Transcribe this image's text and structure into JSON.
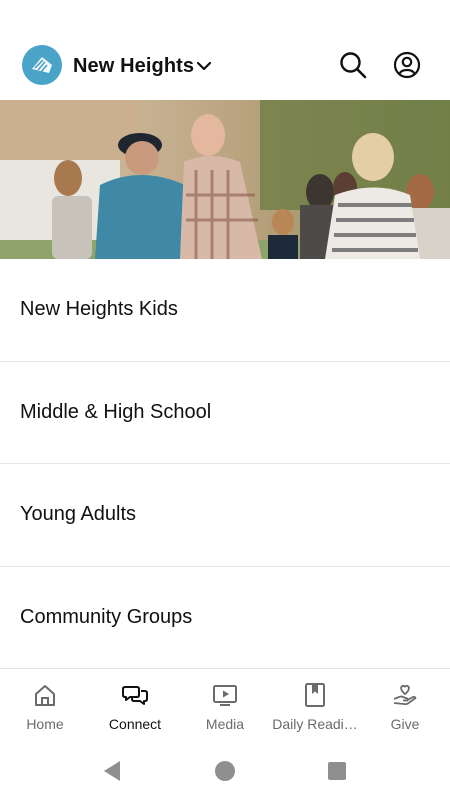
{
  "header": {
    "org_name": "New Heights",
    "logo_icon": "new-heights-logo",
    "dropdown_icon": "chevron-down-icon",
    "search_icon": "search-icon",
    "account_icon": "account-circle-icon",
    "brand_color": "#4aa3c8"
  },
  "hero": {
    "image_description_icon": "hero-photo"
  },
  "menu": {
    "items": [
      {
        "label": "New Heights Kids"
      },
      {
        "label": "Middle & High School"
      },
      {
        "label": "Young Adults"
      },
      {
        "label": "Community Groups"
      }
    ]
  },
  "bottom_nav": {
    "active": "Connect",
    "items": [
      {
        "label": "Home",
        "icon": "home-icon"
      },
      {
        "label": "Connect",
        "icon": "chat-bubbles-icon"
      },
      {
        "label": "Media",
        "icon": "play-screen-icon"
      },
      {
        "label": "Daily Readi…",
        "icon": "bookmark-book-icon"
      },
      {
        "label": "Give",
        "icon": "hand-heart-icon"
      }
    ]
  },
  "system_nav": {
    "back_icon": "back-triangle-icon",
    "home_icon": "home-circle-icon",
    "recents_icon": "recents-square-icon"
  }
}
